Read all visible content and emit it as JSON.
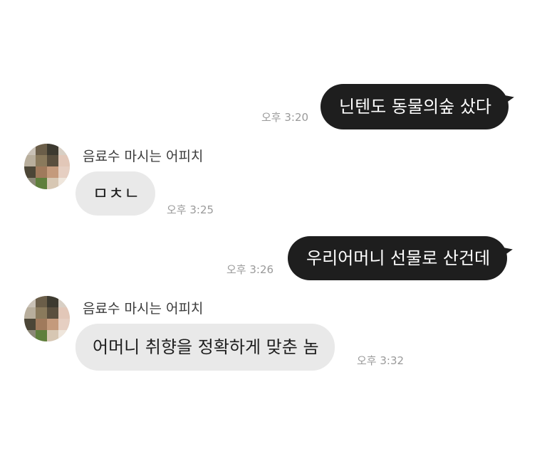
{
  "messages": [
    {
      "direction": "outgoing",
      "text": "닌텐도 동물의숲 샀다",
      "time": "오후 3:20"
    },
    {
      "direction": "incoming",
      "sender": "음료수 마시는 어피치",
      "text": "ㅁㅊㄴ",
      "time": "오후 3:25"
    },
    {
      "direction": "outgoing",
      "text": "우리어머니 선물로 산건데",
      "time": "오후 3:26"
    },
    {
      "direction": "incoming",
      "sender": "음료수 마시는 어피치",
      "text": "어머니 취향을 정확하게 맞춘 놈",
      "time": "오후 3:32"
    }
  ],
  "colors": {
    "outgoing_bubble": "#1e1e1e",
    "incoming_bubble": "#e9e9e9",
    "timestamp": "#9a9a9a"
  },
  "icons": {
    "avatar": "pixelated-avatar-icon"
  }
}
